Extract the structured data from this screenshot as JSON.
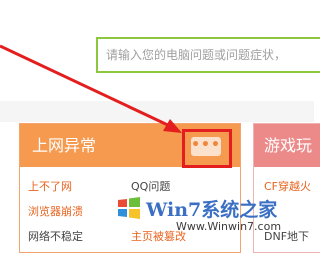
{
  "search": {
    "placeholder": "请输入您的电脑问题或问题症状，"
  },
  "card_internet": {
    "title": "上网异常",
    "more_dots": "•••",
    "links": {
      "cant_connect": "上不了网",
      "qq_issue": "QQ问题",
      "browser_crash": "浏览器崩溃",
      "hijacked": "主页被篡改",
      "unstable": "网络不稳定"
    }
  },
  "card_game": {
    "title": "游戏玩",
    "links": {
      "cf_issue": "CF穿越火",
      "dnf_issue": "DNF地下"
    }
  },
  "watermark": {
    "title": "Win7系统之家",
    "url": "Www.Winwin7.com"
  },
  "colors": {
    "search_border": "#8dc63f",
    "card_header": "#f59a4e",
    "card2_header": "#ec8a8a",
    "highlight_red": "#e41e1e",
    "link_orange": "#e8631e"
  }
}
